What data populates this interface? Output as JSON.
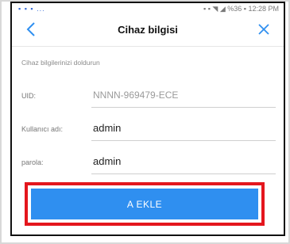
{
  "status_bar": {
    "left_icons": "▪ ▪ ▪ ...",
    "right_text": "▪ ▪ ◥ ◢ %36 ▪ 12:28 PM"
  },
  "header": {
    "title": "Cihaz bilgisi"
  },
  "form": {
    "section_label": "Cihaz bilgilerinizi doldurun",
    "fields": [
      {
        "label": "UID:",
        "value": "NNNN-969479-ECE"
      },
      {
        "label": "Kullanıcı adı:",
        "value": "admin"
      },
      {
        "label": "parola:",
        "value": "admin"
      }
    ]
  },
  "actions": {
    "add_label": "A EKLE"
  },
  "colors": {
    "accent": "#2f8ff0",
    "highlight": "#e4161d"
  }
}
